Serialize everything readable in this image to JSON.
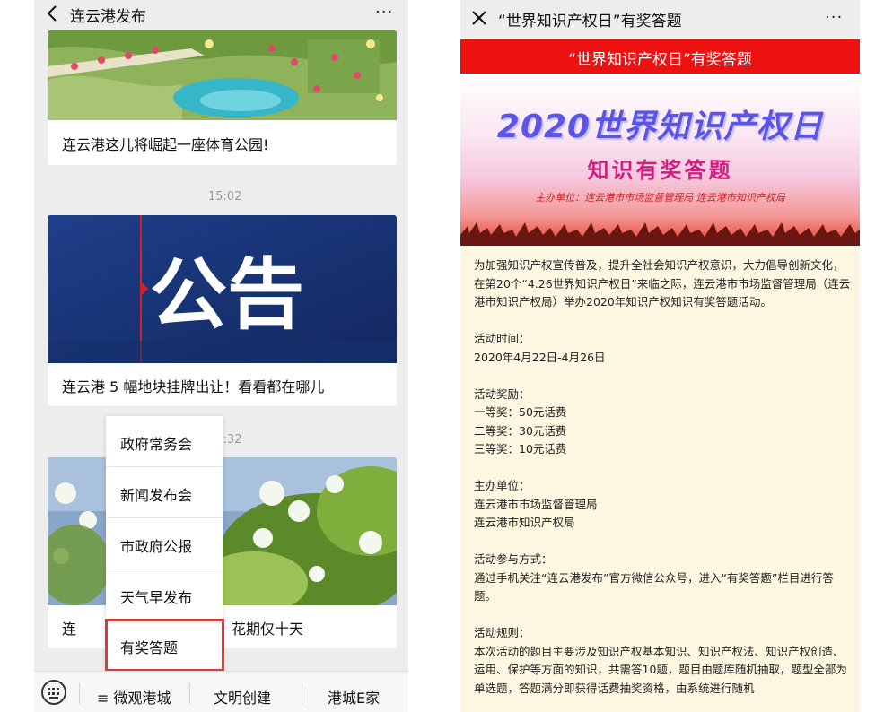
{
  "left": {
    "header": {
      "title": "连云港发布",
      "back_icon": "chevron-left-icon",
      "more_icon": "more-dots-icon",
      "more_glyph": "···"
    },
    "cards": [
      {
        "title": "连云港这儿将崛起一座体育公园!",
        "image": "park-aerial-map-image"
      },
      {
        "title": "连云港 5 幅地块挂牌出让！看看都在哪儿",
        "image": "announcement-image",
        "image_text": "公告"
      },
      {
        "title": "连云港流苏开花！花期仅十天",
        "title_visible_start": "连",
        "title_visible_end": "开花！花期仅十天",
        "image": "white-flowers-image"
      }
    ],
    "timestamps": [
      "15:02",
      "18:32"
    ],
    "popup_menu": [
      {
        "label": "政府常务会"
      },
      {
        "label": "新闻发布会"
      },
      {
        "label": "市政府公报"
      },
      {
        "label": "天气早发布"
      },
      {
        "label": "有奖答题",
        "highlighted": true
      }
    ],
    "bottom_menu": {
      "keyboard_icon": "keyboard-icon",
      "items": [
        "≡ 微观港城",
        "文明创建",
        "港城E家"
      ]
    }
  },
  "right": {
    "header": {
      "title": "“世界知识产权日”有奖答题",
      "close_icon": "close-icon",
      "more_icon": "more-dots-icon",
      "more_glyph": "···"
    },
    "banner_title": "“世界知识产权日”有奖答题",
    "poster": {
      "headline": "2020世界知识产权日",
      "subheadline": "知识有奖答题",
      "organizers": "主办单位：连云港市市场监督管理局 连云港市知识产权局"
    },
    "article": {
      "intro": "为加强知识产权宣传普及，提升全社会知识产权意识，大力倡导创新文化，在第20个“4.26世界知识产权日”来临之际，连云港市市场监督管理局（连云港市知识产权局）举办2020年知识产权知识有奖答题活动。",
      "time_label": "活动时间：",
      "time_value": "2020年4月22日-4月26日",
      "prize_label": "活动奖励：",
      "prizes": [
        "一等奖：50元话费",
        "二等奖：30元话费",
        "三等奖：10元话费"
      ],
      "host_label": "主办单位：",
      "hosts": [
        "连云港市市场监督管理局",
        "连云港市知识产权局"
      ],
      "method_label": "活动参与方式：",
      "method_value": "通过手机关注“连云港发布”官方微信公众号，进入“有奖答题”栏目进行答题。",
      "rules_label": "活动规则：",
      "rules_value": "本次活动的题目主要涉及知识产权基本知识、知识产权法、知识产权创造、运用、保护等方面的知识，共需答10题，题目由题库随机抽取，题型全部为单选题，答题满分即获得话费抽奖资格，由系统进行随机"
    }
  },
  "colors": {
    "highlight_border": "#d93a3a",
    "banner_red": "#ee1111",
    "article_bg": "#fdf6e0",
    "poster_purple": "#5b54e6",
    "poster_pink": "#d11f80"
  }
}
